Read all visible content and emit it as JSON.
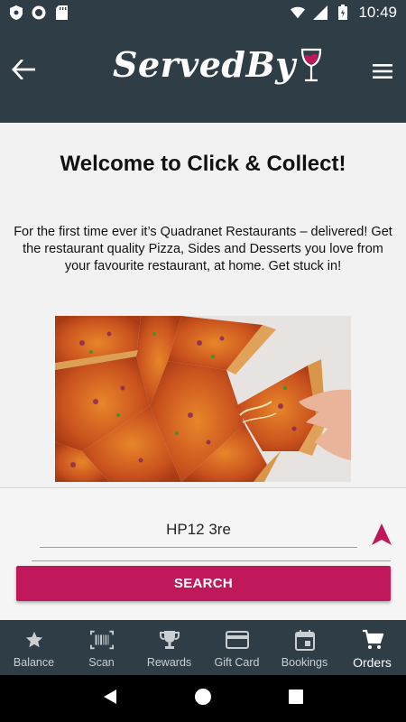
{
  "status_bar": {
    "time": "10:49",
    "icons": [
      "shield-icon",
      "record-icon",
      "sdcard-icon",
      "wifi-icon",
      "signal-icon",
      "battery-icon"
    ]
  },
  "app_bar": {
    "logo_text": "ServedBy",
    "back_icon": "arrow-back-icon",
    "menu_icon": "hamburger-menu-icon"
  },
  "content": {
    "title": "Welcome to Click & Collect!",
    "intro": "For the first time ever it’s Quadranet Restaurants – delivered! Get the restaurant quality Pizza, Sides and Desserts you love from your favourite restaurant, at home. Get stuck in!",
    "hero_image": "pizza-slices-image"
  },
  "search": {
    "postcode_value": "HP12 3re",
    "locate_icon": "navigation-arrow-icon",
    "button_label": "SEARCH"
  },
  "bottom_nav": {
    "items": [
      {
        "label": "Balance",
        "icon": "star-icon",
        "active": false
      },
      {
        "label": "Scan",
        "icon": "barcode-icon",
        "active": false
      },
      {
        "label": "Rewards",
        "icon": "trophy-icon",
        "active": false
      },
      {
        "label": "Gift Card",
        "icon": "credit-card-icon",
        "active": false
      },
      {
        "label": "Bookings",
        "icon": "calendar-icon",
        "active": false
      },
      {
        "label": "Orders",
        "icon": "shopping-cart-icon",
        "active": true
      }
    ]
  },
  "colors": {
    "header_bg": "#2f3d46",
    "accent": "#c0185a",
    "input_underline": "#68c46e"
  }
}
